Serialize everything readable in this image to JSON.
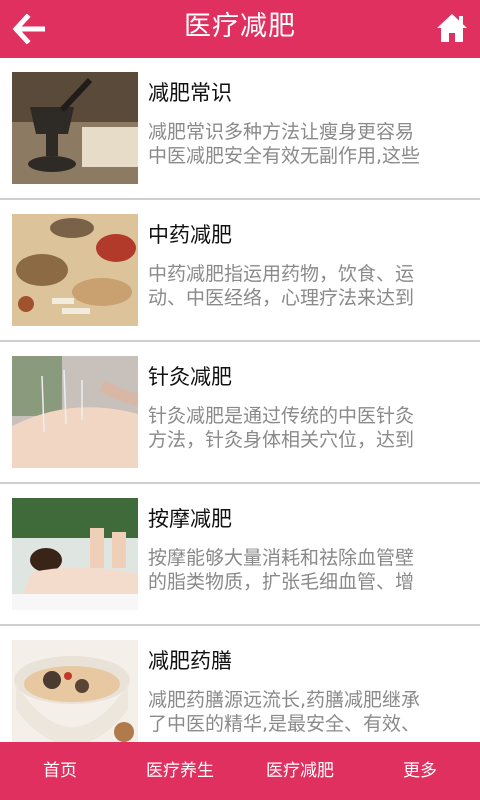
{
  "header": {
    "title": "医疗减肥",
    "back_icon": "arrow-left-icon",
    "home_icon": "home-icon",
    "color": "#e0305f"
  },
  "items": [
    {
      "title": "减肥常识",
      "desc_line1": "减肥常识多种方法让瘦身更容易",
      "desc_line2": "中医减肥安全有效无副作用,这些"
    },
    {
      "title": "中药减肥",
      "desc_line1": "中药减肥指运用药物，饮食、运",
      "desc_line2": "动、中医经络，心理疗法来达到"
    },
    {
      "title": "针灸减肥",
      "desc_line1": "针灸减肥是通过传统的中医针灸",
      "desc_line2": "方法，针灸身体相关穴位，达到"
    },
    {
      "title": "按摩减肥",
      "desc_line1": "按摩能够大量消耗和祛除血管壁",
      "desc_line2": "的脂类物质，扩张毛细血管、增"
    },
    {
      "title": "减肥药膳",
      "desc_line1": "减肥药膳源远流长,药膳减肥继承",
      "desc_line2": "了中医的精华,是最安全、有效、"
    }
  ],
  "tabbar": {
    "tabs": [
      "首页",
      "医疗养生",
      "医疗减肥",
      "更多"
    ]
  }
}
